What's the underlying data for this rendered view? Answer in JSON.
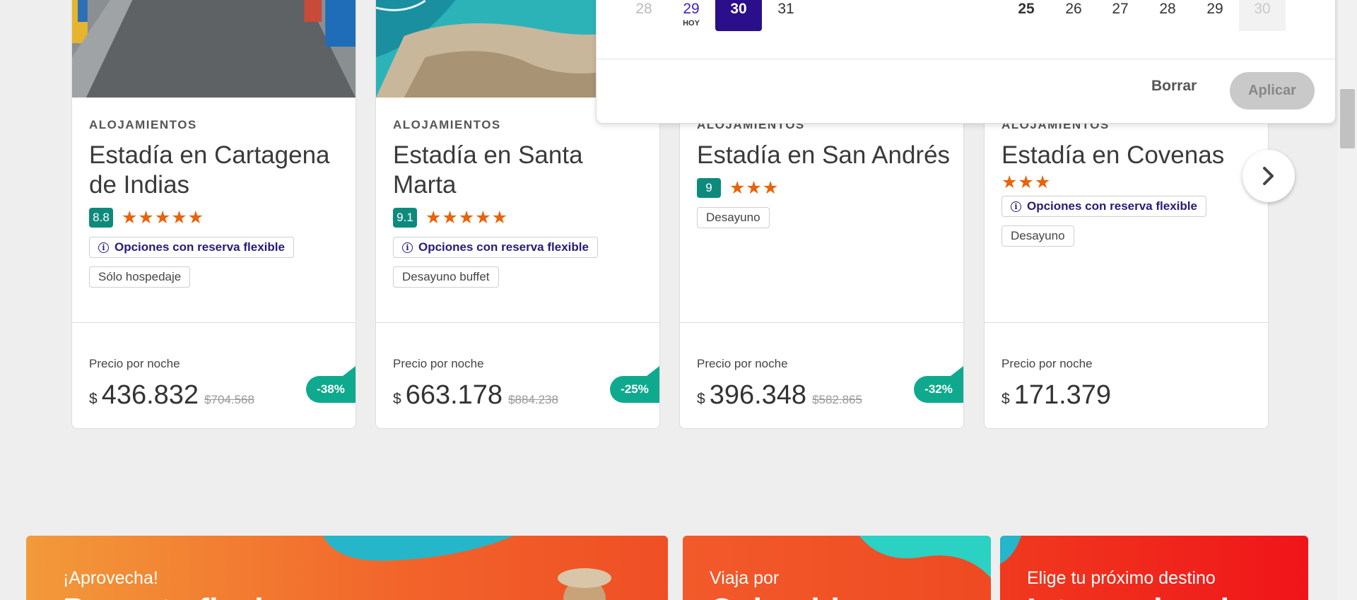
{
  "cards": [
    {
      "category": "ALOJAMIENTOS",
      "title": "Estadía en Cartagena de Indias",
      "score": "8.8",
      "stars": "★★★★★",
      "flexible": "Opciones con reserva flexible",
      "tag": "Sólo hospedaje",
      "price_label": "Precio por noche",
      "currency": "$",
      "price": "436.832",
      "old_price": "$704.568",
      "discount": "-38%"
    },
    {
      "category": "ALOJAMIENTOS",
      "title": "Estadía en Santa Marta",
      "score": "9.1",
      "stars": "★★★★★",
      "flexible": "Opciones con reserva flexible",
      "tag": "Desayuno buffet",
      "price_label": "Precio por noche",
      "currency": "$",
      "price": "663.178",
      "old_price": "$884.238",
      "discount": "-25%"
    },
    {
      "category": "ALOJAMIENTOS",
      "title": "Estadía en San Andrés",
      "score": "9",
      "stars": "★★★",
      "tag": "Desayuno",
      "price_label": "Precio por noche",
      "currency": "$",
      "price": "396.348",
      "old_price": "$582.865",
      "discount": "-32%"
    },
    {
      "category": "ALOJAMIENTOS",
      "title": "Estadía en Covenas",
      "stars": "★★★",
      "flexible": "Opciones con reserva flexible",
      "tag": "Desayuno",
      "price_label": "Precio por noche",
      "currency": "$",
      "price": "171.379"
    }
  ],
  "calendar": {
    "left_month": [
      {
        "day": "28",
        "state": "muted"
      },
      {
        "day": "29",
        "state": "today",
        "sub": "HOY"
      },
      {
        "day": "30",
        "state": "selected"
      },
      {
        "day": "31",
        "state": "normal"
      }
    ],
    "right_month": [
      {
        "day": "25",
        "state": "bold"
      },
      {
        "day": "26",
        "state": "normal"
      },
      {
        "day": "27",
        "state": "normal"
      },
      {
        "day": "28",
        "state": "normal"
      },
      {
        "day": "29",
        "state": "normal"
      },
      {
        "day": "30",
        "state": "disabled"
      }
    ],
    "clear_label": "Borrar",
    "apply_label": "Aplicar"
  },
  "banners": [
    {
      "small": "¡Aprovecha!",
      "big": "Paquete flash"
    },
    {
      "small": "Viaja por",
      "big": "Colombia"
    },
    {
      "small": "Elige tu próximo destino",
      "big": "Internacional"
    }
  ],
  "colors": {
    "brand_purple": "#2a0e8a",
    "discount_green": "#0fa98e",
    "star_orange": "#e8630a",
    "score_teal": "#0e8a7d"
  }
}
